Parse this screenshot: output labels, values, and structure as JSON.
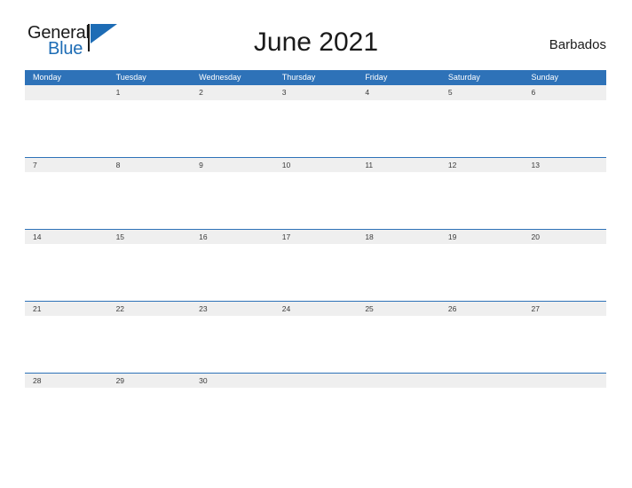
{
  "logo": {
    "word_top": "General",
    "word_bottom": "Blue",
    "flag_icon": "flag-triangle-icon",
    "accent_color": "#1d6cb5"
  },
  "header": {
    "title": "June 2021",
    "country": "Barbados"
  },
  "calendar": {
    "header_bg_color": "#2E72B8",
    "date_band_color": "#EFEFEF",
    "weekdays": [
      "Monday",
      "Tuesday",
      "Wednesday",
      "Thursday",
      "Friday",
      "Saturday",
      "Sunday"
    ],
    "weeks": [
      [
        "",
        "1",
        "2",
        "3",
        "4",
        "5",
        "6"
      ],
      [
        "7",
        "8",
        "9",
        "10",
        "11",
        "12",
        "13"
      ],
      [
        "14",
        "15",
        "16",
        "17",
        "18",
        "19",
        "20"
      ],
      [
        "21",
        "22",
        "23",
        "24",
        "25",
        "26",
        "27"
      ],
      [
        "28",
        "29",
        "30",
        "",
        "",
        "",
        ""
      ]
    ]
  }
}
